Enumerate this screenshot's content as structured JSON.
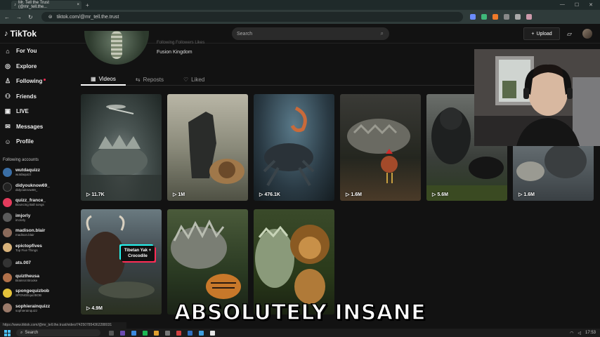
{
  "browser": {
    "tab_title": "Mr. Tell the Trust (@mr_tell.the...",
    "tab_close": "×",
    "new_tab": "+",
    "url": "tiktok.com/@mr_tell.the.trust",
    "status_url": "https://www.tiktok.com/@mr_tell.the.trust/video/742507854362288031"
  },
  "header": {
    "logo": "TikTok",
    "search_placeholder": "Search",
    "upload_label": "Upload"
  },
  "sidebar": {
    "nav": [
      {
        "label": "For You",
        "icon": "home-icon"
      },
      {
        "label": "Explore",
        "icon": "compass-icon"
      },
      {
        "label": "Following",
        "icon": "following-icon"
      },
      {
        "label": "Friends",
        "icon": "friends-icon"
      },
      {
        "label": "LIVE",
        "icon": "live-icon"
      },
      {
        "label": "Messages",
        "icon": "messages-icon"
      },
      {
        "label": "Profile",
        "icon": "profile-icon"
      }
    ],
    "following_title": "Following accounts",
    "accounts": [
      {
        "name": "wutdaquizz",
        "sub": "wutdaquizz",
        "color": "#3a6ea5"
      },
      {
        "name": "didyouknow69_",
        "sub": "didyouknow69_",
        "color": "#222"
      },
      {
        "name": "quizz_france_",
        "sub": "Bouncing Ball songs",
        "color": "#e33b5c"
      },
      {
        "name": "imjorly",
        "sub": "imJorly",
        "color": "#5a5a5a"
      },
      {
        "name": "madison.blair",
        "sub": "madison.blair",
        "color": "#8a6a5a"
      },
      {
        "name": "epictopfives",
        "sub": "Top Five Things",
        "color": "#d8b27a"
      },
      {
        "name": "ats.007",
        "sub": "",
        "color": "#333"
      },
      {
        "name": "quiztheusa",
        "sub": "Brainrot Brooke",
        "color": "#b0704a"
      },
      {
        "name": "spongequizbob",
        "sub": "SPONGEquizBOB",
        "color": "#e4c23a"
      },
      {
        "name": "sophierainquizz",
        "sub": "sophierainquizz",
        "color": "#9a7a6a"
      }
    ]
  },
  "profile": {
    "bio": "Fusion Kingdom",
    "faded_stats": "Following   Followers   Likes",
    "tabs": [
      {
        "label": "Videos",
        "icon": "grid-icon"
      },
      {
        "label": "Reposts",
        "icon": "repost-icon"
      },
      {
        "label": "Liked",
        "icon": "heart-icon"
      }
    ]
  },
  "videos": [
    {
      "views": "11.7K"
    },
    {
      "views": "1M"
    },
    {
      "views": "476.1K"
    },
    {
      "views": "1.6M"
    },
    {
      "views": "5.6M"
    },
    {
      "views": "1.6M"
    },
    {
      "views": "4.9M",
      "label": "Tibetan Yak + Crocodile"
    },
    {
      "views": ""
    },
    {
      "views": ""
    }
  ],
  "caption": "ABSOLUTELY INSANE",
  "taskbar": {
    "search": "Search",
    "time": "17:53"
  }
}
